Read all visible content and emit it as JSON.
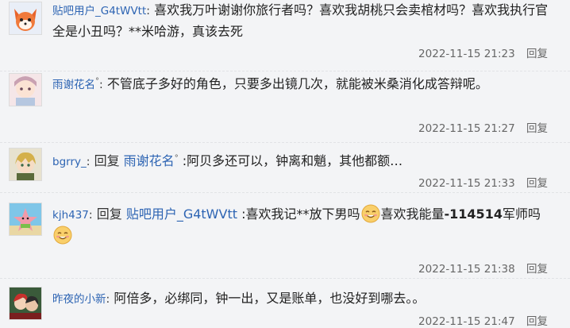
{
  "replies": [
    {
      "username": "贴吧用户_G4tWVtt",
      "separator": ":",
      "text": "喜欢我万叶谢谢你旅行者吗？喜欢我胡桃只会卖棺材吗？喜欢我执行官全是小丑吗？**米哈游，真该去死",
      "time": "2022-11-15 21:23",
      "reply_label": "回复",
      "avatar": "fox-avatar-icon"
    },
    {
      "username": "雨谢花名",
      "badge": "°",
      "separator": ":",
      "text": "不管底子多好的角色，只要多出镜几次，就能被米桑消化成答辩呢。",
      "time": "2022-11-15 21:27",
      "reply_label": "回复",
      "avatar": "anime-girl-avatar-icon"
    },
    {
      "username": "bgrry_",
      "separator": ":",
      "reply_word": "回复",
      "target": "雨谢花名",
      "target_badge": "°",
      "text": ":阿贝多还可以，钟离和魈，其他都额…",
      "time": "2022-11-15 21:33",
      "reply_label": "回复",
      "avatar": "blond-character-avatar-icon"
    },
    {
      "username": "kjh437",
      "separator": ":",
      "reply_word": "回复",
      "target": "贴吧用户_G4tWVtt",
      "text_part1": ":喜欢我记**放下男吗",
      "text_part2": "喜欢我能量",
      "text_bold": "-114514",
      "text_part3": "军师吗",
      "time": "2022-11-15 21:38",
      "reply_label": "回复",
      "avatar": "starfish-avatar-icon",
      "emoji": "smile-emoji-icon"
    },
    {
      "username": "昨夜的小新",
      "separator": ":",
      "text": "阿倍多，必绑同，钟一出，又是账单，也没好到哪去。。",
      "time": "2022-11-15 21:47",
      "reply_label": "回复",
      "avatar": "red-hair-avatar-icon"
    }
  ]
}
